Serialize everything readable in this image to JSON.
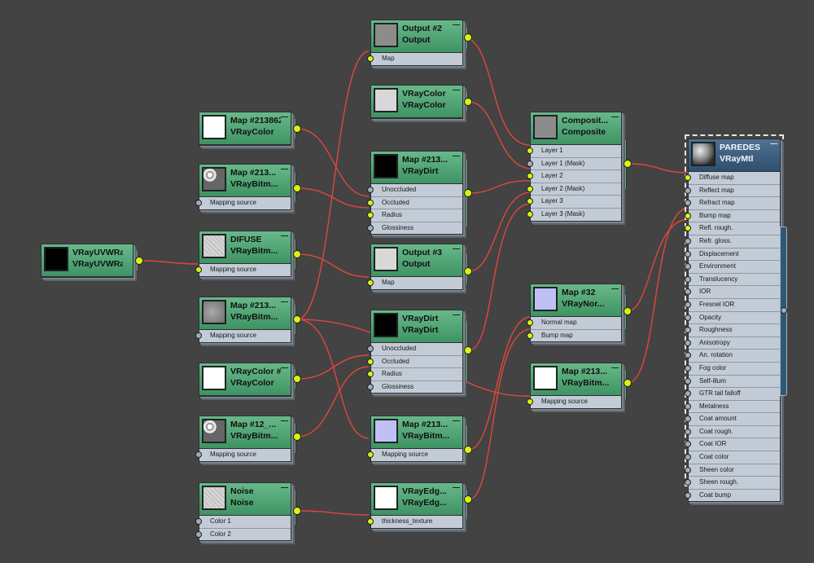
{
  "nodes": {
    "output2": {
      "title": "Output #2",
      "type": "Output",
      "slots": [
        "Map"
      ]
    },
    "vraycolor_top": {
      "title": "VRayColor",
      "type": "VRayColor",
      "slots": []
    },
    "map_213862": {
      "title": "Map #213862...",
      "type": "VRayColor",
      "slots": []
    },
    "map_vraybitm_a": {
      "title": "Map #213...",
      "type": "VRayBitm...",
      "slots": [
        "Mapping source"
      ]
    },
    "vraydirt_a": {
      "title": "Map #213...",
      "type": "VRayDirt",
      "slots": [
        "Unoccluded",
        "Occluded",
        "Radius",
        "Glossiness"
      ]
    },
    "composite": {
      "title": "Composit...",
      "type": "Composite",
      "slots": [
        "Layer 1",
        "Layer 1 (Mask)",
        "Layer 2",
        "Layer 2 (Mask)",
        "Layer 3",
        "Layer 3 (Mask)"
      ]
    },
    "uvw": {
      "title": "VRayUVWRa...",
      "type": "VRayUVWRa...",
      "slots": []
    },
    "difuse": {
      "title": "DIFUSE",
      "type": "VRayBitm...",
      "slots": [
        "Mapping source"
      ]
    },
    "output3": {
      "title": "Output #3",
      "type": "Output",
      "slots": [
        "Map"
      ]
    },
    "map_vraybitm_b": {
      "title": "Map #213...",
      "type": "VRayBitm...",
      "slots": [
        "Mapping source"
      ]
    },
    "vraydirt_b": {
      "title": "VRayDirt",
      "type": "VRayDirt",
      "slots": [
        "Unoccluded",
        "Occluded",
        "Radius",
        "Glossiness"
      ]
    },
    "map32": {
      "title": "Map #32",
      "type": "VRayNor...",
      "slots": [
        "Normal map",
        "Bump map"
      ]
    },
    "vraycolor2": {
      "title": "VRayColor #2",
      "type": "VRayColor",
      "slots": []
    },
    "map_vraybitm_c": {
      "title": "Map #213...",
      "type": "VRayBitm...",
      "slots": [
        "Mapping source"
      ]
    },
    "map12": {
      "title": "Map #12_...",
      "type": "VRayBitm...",
      "slots": [
        "Mapping source"
      ]
    },
    "map_vraybitm_d": {
      "title": "Map #213...",
      "type": "VRayBitm...",
      "slots": [
        "Mapping source"
      ]
    },
    "noise": {
      "title": "Noise",
      "type": "Noise",
      "slots": [
        "Color 1",
        "Color 2"
      ]
    },
    "vrayedge": {
      "title": "VRayEdg...",
      "type": "VRayEdg...",
      "slots": [
        "thickness_texture"
      ]
    },
    "paredes": {
      "title": "PAREDES",
      "type": "VRayMtl",
      "slots": [
        "Diffuse map",
        "Reflect map",
        "Refract map",
        "Bump map",
        "Refl. rough.",
        "Refr. gloss.",
        "Displacement",
        "Environment",
        "Translucency",
        "IOR",
        "Fresnel IOR",
        "Opacity",
        "Roughness",
        "Anisotropy",
        "An. rotation",
        "Fog color",
        "Self-illum",
        "GTR tail falloff",
        "Metalness",
        "Coat amount",
        "Coat rough.",
        "Coat IOR",
        "Coat color",
        "Sheen color",
        "Sheen rough.",
        "Coat bump"
      ]
    }
  },
  "colors": {
    "canvas": "#434343",
    "node_header": "#4fa572",
    "material_header": "#3d6080",
    "wire": "#e0473c",
    "socket_connected": "#d6f50c",
    "socket_empty": "#a2adb9"
  }
}
